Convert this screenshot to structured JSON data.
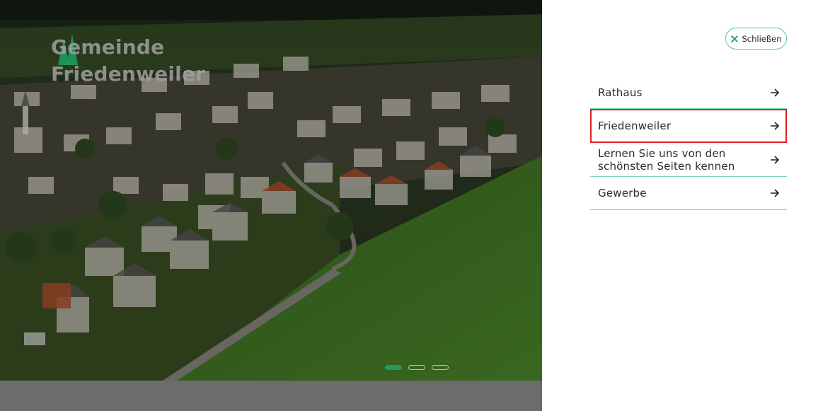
{
  "logo": {
    "line1": "Gemeinde",
    "line2": "Friedenweiler"
  },
  "slider": {
    "total": 3,
    "active": 1
  },
  "close_button": {
    "label": "Schließen"
  },
  "menu": {
    "items": [
      {
        "label": "Rathaus"
      },
      {
        "label": "Friedenweiler"
      },
      {
        "label": "Lernen Sie uns von den schönsten Seiten kennen"
      },
      {
        "label": "Gewerbe"
      }
    ]
  },
  "colors": {
    "accent": "#1e9b5e",
    "divider": "#7fd4ab",
    "highlight": "#e01f1f"
  }
}
